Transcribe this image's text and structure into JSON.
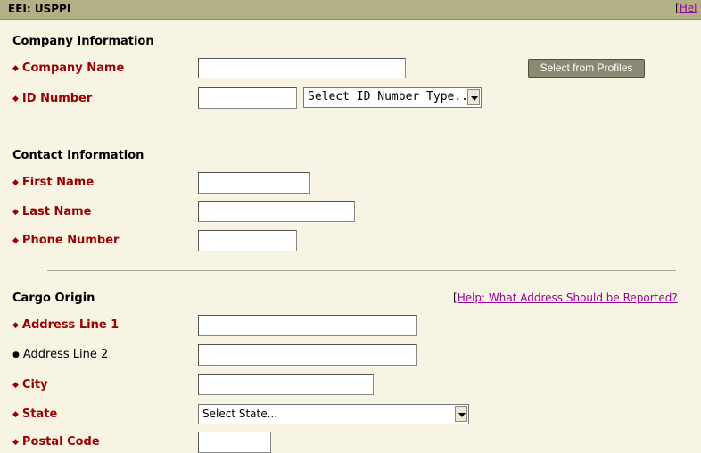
{
  "header": {
    "title": "EEI: USPPI",
    "help_bracket": "[",
    "help_label": "Hel"
  },
  "company": {
    "section_title": "Company Information",
    "company_name_label": "Company Name",
    "select_profiles_label": "Select from Profiles",
    "id_number_label": "ID Number",
    "id_type_select": "Select ID Number Type..."
  },
  "contact": {
    "section_title": "Contact Information",
    "first_name_label": "First Name",
    "last_name_label": "Last Name",
    "phone_label": "Phone Number"
  },
  "cargo": {
    "section_title": "Cargo Origin",
    "help_bracket": "[",
    "help_label": "Help: What Address Should be Reported?",
    "address1_label": "Address Line 1",
    "address2_label": "Address Line 2",
    "city_label": "City",
    "state_label": "State",
    "state_select": "Select State...",
    "postal_label": "Postal Code"
  },
  "markers": {
    "required": "◆",
    "optional": "●"
  },
  "colors": {
    "title_bar": "#b3b086",
    "required_label": "#990000",
    "link": "#990099",
    "background": "#f8f4e4"
  }
}
